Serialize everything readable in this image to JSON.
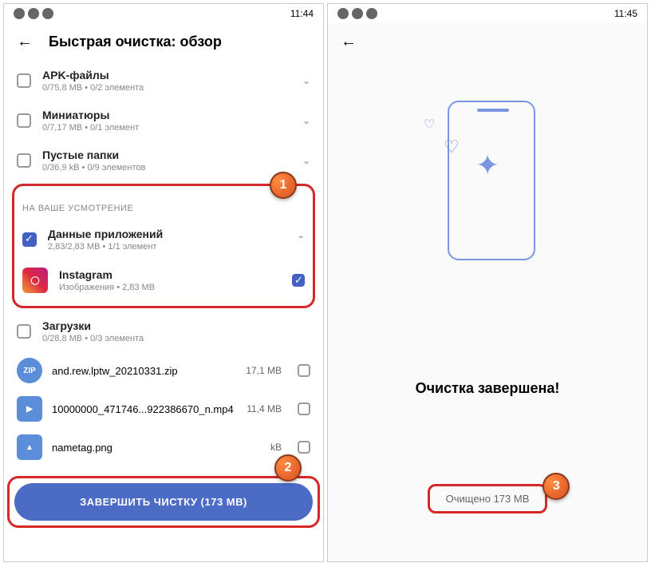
{
  "phone1": {
    "time": "11:44",
    "title": "Быстрая очистка: обзор",
    "items": [
      {
        "title": "APK-файлы",
        "sub": "0/75,8 MB • 0/2 элемента"
      },
      {
        "title": "Миниатюры",
        "sub": "0/7,17 MB • 0/1 элемент"
      },
      {
        "title": "Пустые папки",
        "sub": "0/36,9 kB • 0/9 элементов"
      }
    ],
    "section": "НА ВАШЕ УСМОТРЕНИЕ",
    "appdata": {
      "title": "Данные приложений",
      "sub": "2,83/2,83 MB • 1/1 элемент"
    },
    "instagram": {
      "title": "Instagram",
      "sub": "Изображения • 2,83 MB"
    },
    "downloads": {
      "title": "Загрузки",
      "sub": "0/28,8 MB • 0/3 элемента"
    },
    "files": [
      {
        "icon": "ZIP",
        "name": "and.rew.lptw_20210331.zip",
        "size": "17,1 MB"
      },
      {
        "icon": "▶",
        "name": "10000000_471746...922386670_n.mp4",
        "size": "11,4 MB"
      },
      {
        "icon": "▲",
        "name": "nametag.png",
        "size": "kB"
      }
    ],
    "button": "ЗАВЕРШИТЬ ЧИСТКУ (173 MB)"
  },
  "phone2": {
    "time": "11:45",
    "done": "Очистка завершена!",
    "cleaned": "Очищено 173 MB"
  },
  "callouts": {
    "c1": "1",
    "c2": "2",
    "c3": "3"
  }
}
